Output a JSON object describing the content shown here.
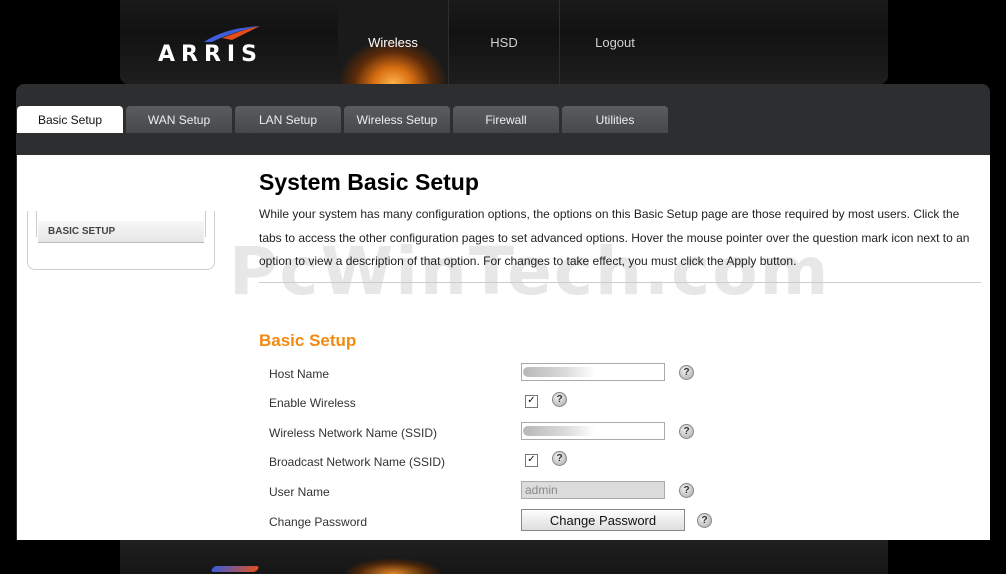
{
  "brand": {
    "logo_text": "ARRIS",
    "swoosh_colors": [
      "#3f5fd9",
      "#e34d1d"
    ]
  },
  "main_nav": [
    {
      "label": "Wireless",
      "active": true
    },
    {
      "label": "HSD",
      "active": false
    },
    {
      "label": "Logout",
      "active": false
    }
  ],
  "tabs": [
    {
      "label": "Basic Setup",
      "active": true
    },
    {
      "label": "WAN Setup",
      "active": false
    },
    {
      "label": "LAN Setup",
      "active": false
    },
    {
      "label": "Wireless Setup",
      "active": false
    },
    {
      "label": "Firewall",
      "active": false
    },
    {
      "label": "Utilities",
      "active": false
    }
  ],
  "sidebar": {
    "items": [
      {
        "label": "BASIC SETUP"
      }
    ]
  },
  "page": {
    "title": "System Basic Setup",
    "intro": "While your system has many configuration options, the options on this Basic Setup page are those required by most users. Click the tabs to access the other configuration pages to set advanced options. Hover the mouse pointer over the question mark icon next to an option to view a description of that option. For changes to take effect, you must click the Apply button.",
    "watermark": "PcWinTech.com"
  },
  "basic_setup": {
    "section_title": "Basic Setup",
    "host_name": {
      "label": "Host Name",
      "value": ""
    },
    "enable_wireless": {
      "label": "Enable Wireless",
      "checked": true,
      "mark": "✓"
    },
    "ssid": {
      "label": "Wireless Network Name (SSID)",
      "value": ""
    },
    "broadcast_ssid": {
      "label": "Broadcast Network Name (SSID)",
      "checked": true,
      "mark": "✓"
    },
    "user_name": {
      "label": "User Name",
      "value": "admin"
    },
    "change_password": {
      "label": "Change Password",
      "button_label": "Change Password"
    },
    "help_glyph": "?"
  },
  "colors": {
    "accent": "#f28a12",
    "tab_bar": "#2c2e30",
    "active_glow": "#d86f12"
  }
}
